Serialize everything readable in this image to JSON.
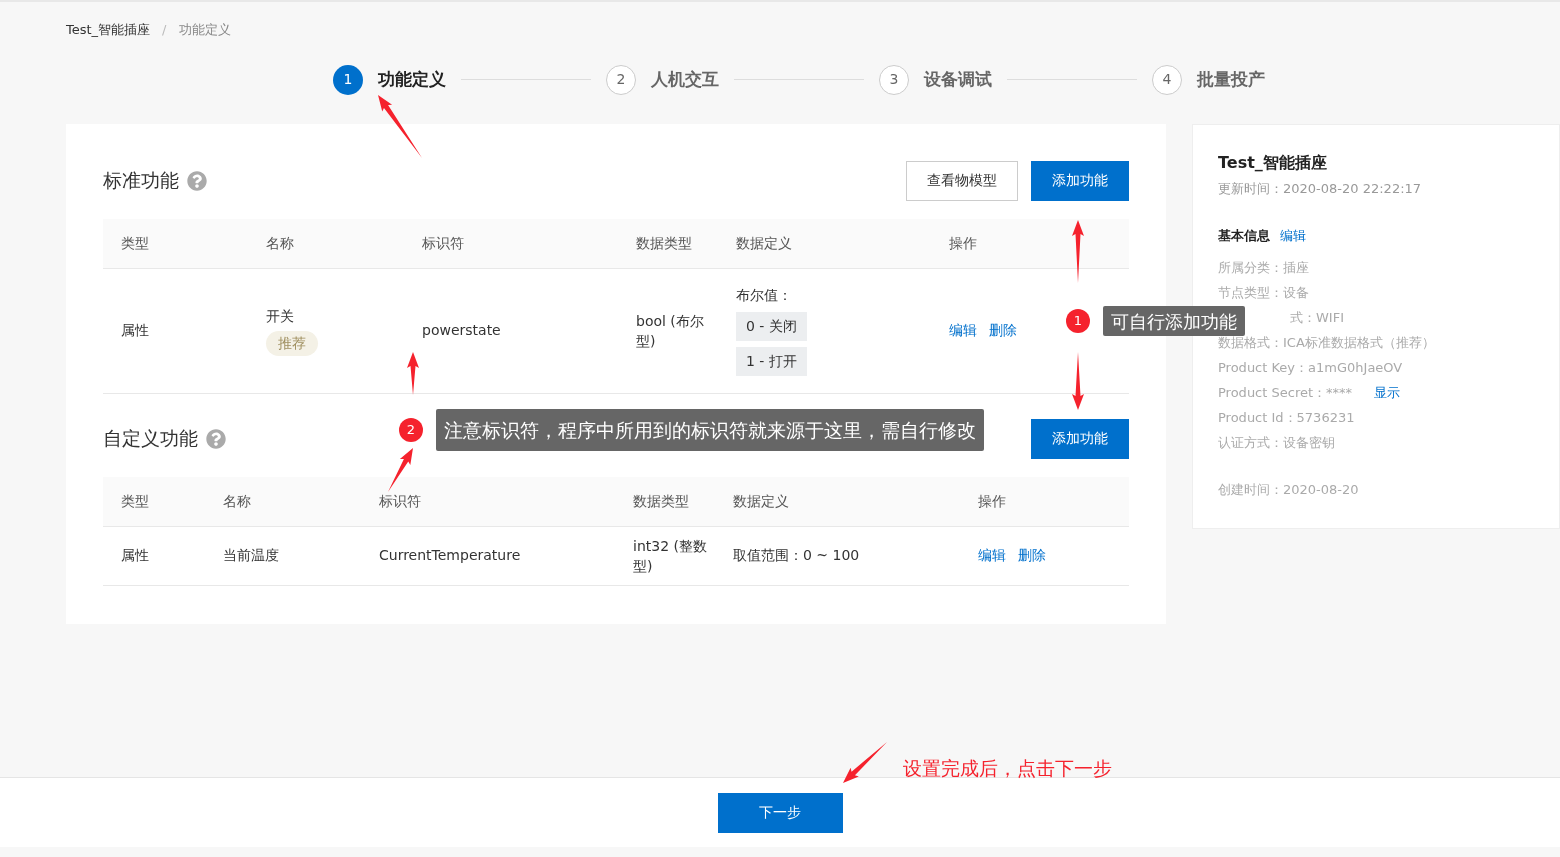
{
  "breadcrumb": [
    "Test_智能插座",
    "功能定义"
  ],
  "breadcrumb_separator": "/",
  "steps": [
    {
      "number": "1",
      "label": "功能定义",
      "selected": true
    },
    {
      "number": "2",
      "label": "人机交互",
      "selected": false
    },
    {
      "number": "3",
      "label": "设备调试",
      "selected": false
    },
    {
      "number": "4",
      "label": "批量投产",
      "selected": false
    }
  ],
  "standard": {
    "title": "标准功能",
    "buttons": [
      {
        "label": "查看物模型",
        "kind": "secondary"
      },
      {
        "label": "添加功能",
        "kind": "primary"
      }
    ],
    "columns": [
      "类型",
      "名称",
      "标识符",
      "数据类型",
      "数据定义",
      "操作"
    ],
    "rows": [
      {
        "type": "属性",
        "name": "开关",
        "tag": "推荐",
        "identifier": "powerstate",
        "data_type": "bool (布尔型)",
        "definition_label": "布尔值：",
        "definition_values": [
          "0 - 关闭",
          "1 - 打开"
        ],
        "actions": [
          "编辑",
          "删除"
        ]
      }
    ]
  },
  "custom": {
    "title": "自定义功能",
    "buttons": [
      {
        "label": "添加功能",
        "kind": "primary"
      }
    ],
    "columns": [
      "类型",
      "名称",
      "标识符",
      "数据类型",
      "数据定义",
      "操作"
    ],
    "rows": [
      {
        "type": "属性",
        "name": "当前温度",
        "identifier": "CurrentTemperature",
        "data_type": "int32 (整数型)",
        "definition": "取值范围：0 ~ 100",
        "actions": [
          "编辑",
          "删除"
        ]
      }
    ]
  },
  "product": {
    "title": "Test_智能插座",
    "updated": "更新时间：2020-08-20 22:22:17",
    "section": "基本信息",
    "section_link": "编辑",
    "info": [
      {
        "text": "所属分类：插座"
      },
      {
        "text": "节点类型：设备"
      },
      {
        "text": "式：WIFI",
        "partly_hidden": true
      },
      {
        "text": "数据格式：ICA标准数据格式（推荐）"
      },
      {
        "text": "Product Key：a1mG0hJaeOV"
      },
      {
        "text": "Product Secret：****",
        "link": "显示"
      },
      {
        "text": "Product Id：5736231"
      },
      {
        "text": "认证方式：设备密钥"
      }
    ],
    "created": "创建时间：2020-08-20"
  },
  "annotations": [
    {
      "number": "1",
      "text": "可自行添加功能"
    },
    {
      "number": "2",
      "text": "注意标识符，程序中所用到的标识符就来源于这里，需自行修改"
    }
  ],
  "footer_note": "设置完成后，点击下一步",
  "next_button": "下一步"
}
